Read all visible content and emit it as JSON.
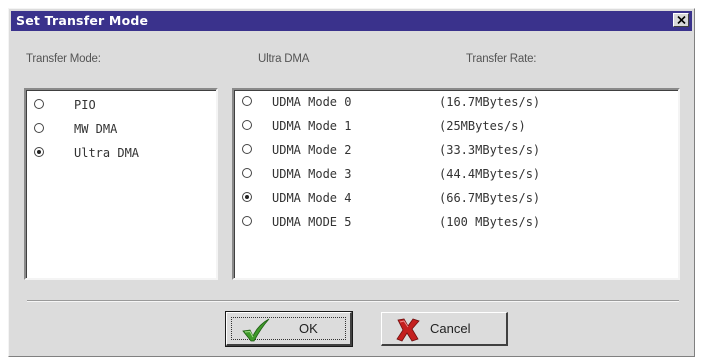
{
  "window": {
    "title": "Set Transfer Mode"
  },
  "headers": {
    "transfer_mode": "Transfer Mode:",
    "ultra_dma": "Ultra DMA",
    "transfer_rate": "Transfer Rate:"
  },
  "transfer_modes": [
    {
      "label": "PIO",
      "selected": false
    },
    {
      "label": "MW DMA",
      "selected": false
    },
    {
      "label": "Ultra DMA",
      "selected": true
    }
  ],
  "udma_modes": [
    {
      "label": "UDMA Mode 0",
      "rate": "(16.7MBytes/s)",
      "selected": false
    },
    {
      "label": "UDMA Mode 1",
      "rate": "(25MBytes/s)",
      "selected": false
    },
    {
      "label": "UDMA Mode 2",
      "rate": "(33.3MBytes/s)",
      "selected": false
    },
    {
      "label": "UDMA Mode 3",
      "rate": "(44.4MBytes/s)",
      "selected": false
    },
    {
      "label": "UDMA Mode 4",
      "rate": "(66.7MBytes/s)",
      "selected": true
    },
    {
      "label": "UDMA MODE 5",
      "rate": "(100 MBytes/s)",
      "selected": false
    }
  ],
  "buttons": {
    "ok_label": "OK",
    "cancel_label": "Cancel"
  },
  "icons": {
    "close": "close-icon",
    "ok": "checkmark-icon",
    "cancel": "red-x-icon"
  },
  "colors": {
    "titlebar": "#3a328c",
    "dialog": "#dcdcdc",
    "ok_check": "#3f9a2a",
    "cancel_x": "#c4201f"
  }
}
